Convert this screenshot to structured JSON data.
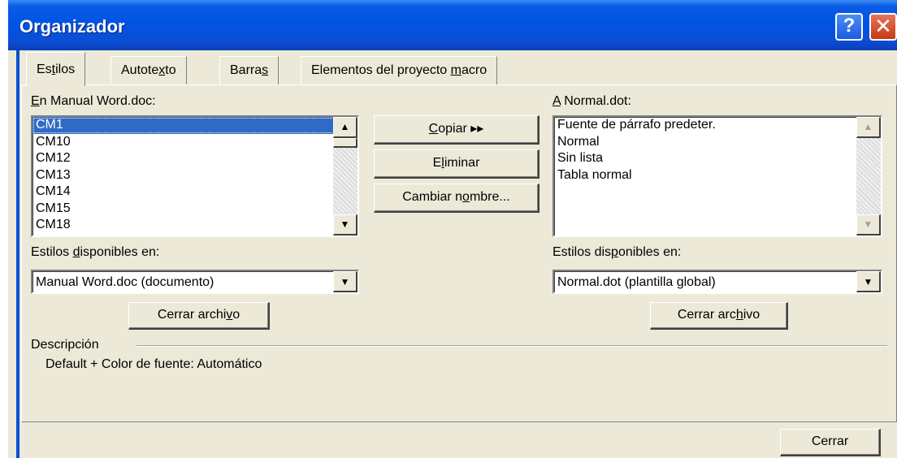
{
  "window": {
    "title": "Organizador",
    "help_glyph": "?",
    "close_glyph": "✕"
  },
  "tabs": [
    {
      "pre": "Es",
      "u": "t",
      "post": "ilos"
    },
    {
      "pre": "Autote",
      "u": "x",
      "post": "to"
    },
    {
      "pre": "Barra",
      "u": "s",
      "post": ""
    },
    {
      "pre": "Elementos del proyecto ",
      "u": "m",
      "post": "acro"
    }
  ],
  "left": {
    "label": {
      "pre": "",
      "u": "E",
      "post": "n Manual Word.doc:"
    },
    "items": [
      "CM1",
      "CM10",
      "CM12",
      "CM13",
      "CM14",
      "CM15",
      "CM18"
    ],
    "selected_index": 0,
    "available_label": {
      "pre": "Estilos ",
      "u": "d",
      "post": "isponibles en:"
    },
    "available_value": "Manual Word.doc (documento)",
    "close_file": {
      "pre": "Cerrar archi",
      "u": "v",
      "post": "o"
    }
  },
  "right": {
    "label": {
      "pre": "",
      "u": "A",
      "post": " Normal.dot:"
    },
    "items": [
      "Fuente de párrafo predeter.",
      "Normal",
      "Sin lista",
      "Tabla normal"
    ],
    "available_label": {
      "pre": "Estilos dis",
      "u": "p",
      "post": "onibles en:"
    },
    "available_value": "Normal.dot (plantilla global)",
    "close_file": {
      "pre": "Cerrar arc",
      "u": "h",
      "post": "ivo"
    }
  },
  "actions": {
    "copy": {
      "pre": "",
      "u": "C",
      "post": "opiar ▸▸"
    },
    "delete": {
      "pre": "E",
      "u": "l",
      "post": "iminar"
    },
    "rename": {
      "pre": "Cambiar n",
      "u": "o",
      "post": "mbre..."
    }
  },
  "description": {
    "label": "Descripción",
    "text": "Default + Color de fuente: Automático"
  },
  "footer": {
    "close_label": "Cerrar"
  },
  "colors": {
    "titlebar": "#0054e3",
    "face": "#ece9d8",
    "selection": "#316ac5"
  }
}
